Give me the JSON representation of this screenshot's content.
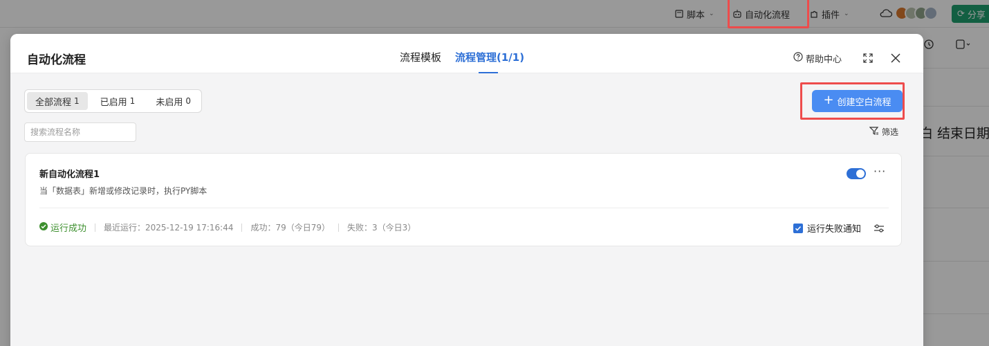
{
  "topbar": {
    "script_label": "脚本",
    "automation_label": "自动化流程",
    "plugin_label": "插件",
    "share_label": "分享"
  },
  "background": {
    "column_header": "白 结束日期"
  },
  "modal": {
    "title": "自动化流程",
    "tabs": [
      {
        "label": "流程模板",
        "active": false
      },
      {
        "label": "流程管理(1/1)",
        "active": true
      }
    ],
    "help_label": "帮助中心",
    "segments": [
      {
        "label": "全部流程",
        "count": "1",
        "active": true
      },
      {
        "label": "已启用",
        "count": "1",
        "active": false
      },
      {
        "label": "未启用",
        "count": "0",
        "active": false
      }
    ],
    "search_placeholder": "搜索流程名称",
    "create_label": "创建空白流程",
    "filter_label": "筛选"
  },
  "flow": {
    "name": "新自动化流程1",
    "description": "当「数据表」新增或修改记录时，执行PY脚本",
    "enabled": true,
    "status": "运行成功",
    "last_run": "最近运行：2025-12-19 17:16:44",
    "success": "成功：79（今日79）",
    "failure": "失败：3（今日3）",
    "notify_label": "运行失败通知",
    "notify_checked": true
  },
  "colors": {
    "accent": "#2d6fd6",
    "create_button": "#4a8cf2",
    "success": "#3d8f2e",
    "highlight": "#ee4c4c",
    "share": "#1f9e6e"
  }
}
